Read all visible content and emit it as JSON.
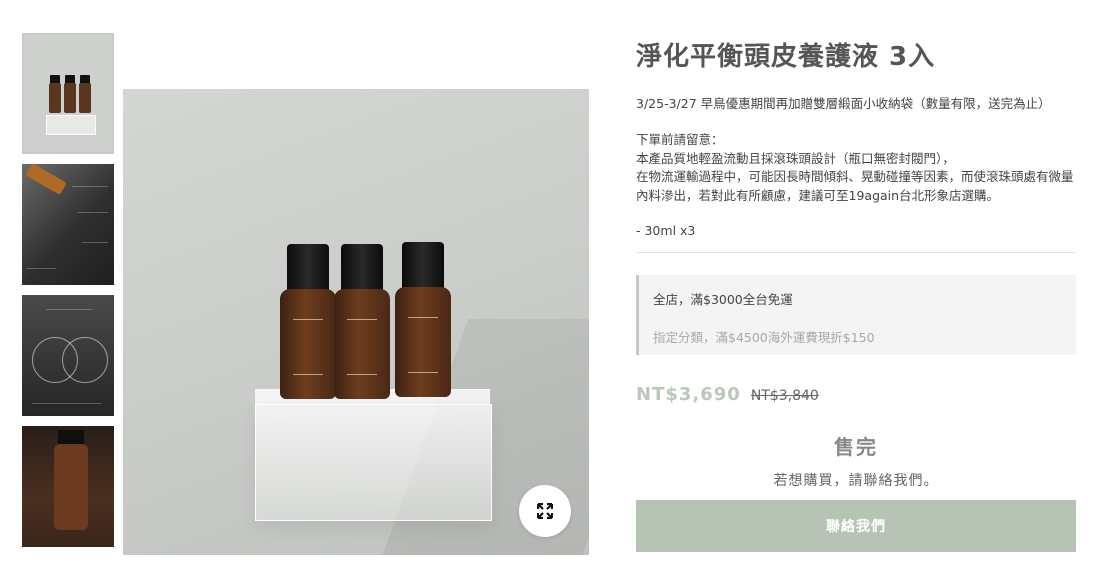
{
  "product": {
    "title": "淨化平衡頭皮養護液 3入",
    "promo": "3/25-3/27 早鳥優惠期間再加贈雙層緞面小收納袋（數量有限，送完為止）",
    "notice": [
      "下單前請留意：",
      "本產品質地輕盈流動且採滾珠頭設計（瓶口無密封閥門），",
      "在物流運輸過程中，可能因長時間傾斜、晃動碰撞等因素，而使滾珠頭處有微量",
      "內料滲出，若對此有所顧慮，建議可至19again台北形象店選購。"
    ],
    "spec": "- 30ml x3"
  },
  "shipping": {
    "line1": "全店，滿$3000全台免運",
    "line2": "指定分類，滿$4500海外運費現折$150"
  },
  "pricing": {
    "sale_price": "NT$3,690",
    "original_price": "NT$3,840"
  },
  "purchase": {
    "sold_out": "售完",
    "contact_prompt": "若想購買，請聯絡我們。",
    "contact_button": "聯絡我們"
  },
  "gallery": {
    "thumbnails": [
      "product-bottles-thumb",
      "scalp-dropper-thumb",
      "ingredient-circles-thumb",
      "bottle-in-hand-thumb"
    ],
    "active_index": 0,
    "expand_icon": "expand-icon"
  },
  "colors": {
    "accent": "#b7c4b5",
    "price": "#b9c8b8",
    "ship_border": "#c3ccc2"
  }
}
